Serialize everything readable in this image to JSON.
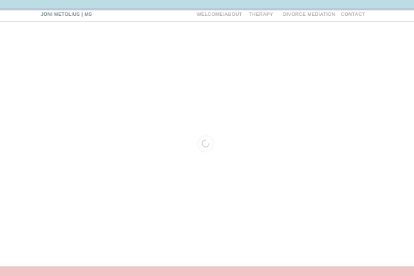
{
  "header": {
    "brand": "JONI METOLIUS | MS",
    "nav": [
      {
        "label": "WELCOME/ABOUT"
      },
      {
        "label": "THERAPY"
      },
      {
        "label": "DIVORCE MEDIATION"
      },
      {
        "label": "CONTACT"
      }
    ]
  },
  "main": {
    "loading_indicator": "spinner-icon"
  },
  "colors": {
    "top_stripe": "#bcdde3",
    "top_stripe_secondary": "#b9c6d9",
    "footer_band": "#f0c7c6",
    "brand_text": "#7c8f95",
    "nav_text": "#b4b4b4"
  }
}
